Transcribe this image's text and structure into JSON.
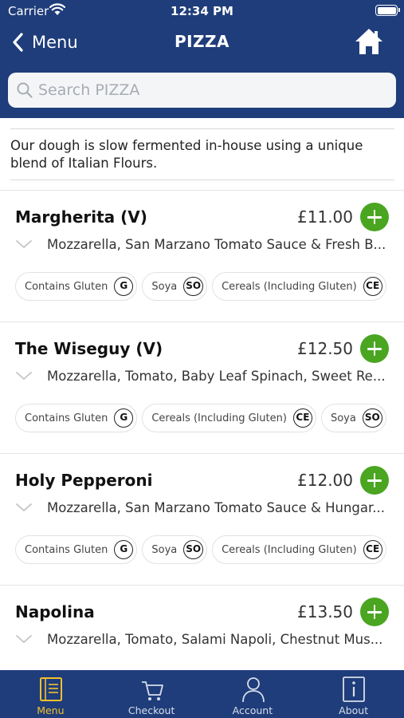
{
  "status_bar": {
    "carrier": "Carrier",
    "time": "12:34 PM",
    "battery_level": 1.0
  },
  "nav": {
    "back_label": "Menu",
    "title": "PIZZA"
  },
  "search": {
    "placeholder": "Search PIZZA",
    "value": ""
  },
  "intro_text": "Our dough is slow fermented in-house using a unique blend of Italian Flours.",
  "items": [
    {
      "name": "Margherita (V)",
      "price": "£11.00",
      "description": "Mozzarella, San Marzano Tomato Sauce & Fresh B...",
      "allergens": [
        {
          "label": "Contains Gluten",
          "code": "G"
        },
        {
          "label": "Soya",
          "code": "SO"
        },
        {
          "label": "Cereals (Including Gluten)",
          "code": "CE"
        }
      ]
    },
    {
      "name": "The Wiseguy (V)",
      "price": "£12.50",
      "description": "Mozzarella, Tomato, Baby Leaf Spinach, Sweet Re...",
      "allergens": [
        {
          "label": "Contains Gluten",
          "code": "G"
        },
        {
          "label": "Cereals (Including Gluten)",
          "code": "CE"
        },
        {
          "label": "Soya",
          "code": "SO"
        }
      ]
    },
    {
      "name": "Holy Pepperoni",
      "price": "£12.00",
      "description": "Mozzarella, San Marzano Tomato Sauce & Hungar...",
      "allergens": [
        {
          "label": "Contains Gluten",
          "code": "G"
        },
        {
          "label": "Soya",
          "code": "SO"
        },
        {
          "label": "Cereals (Including Gluten)",
          "code": "CE"
        }
      ]
    },
    {
      "name": "Napolina",
      "price": "£13.50",
      "description": "Mozzarella, Tomato, Salami Napoli, Chestnut Mus...",
      "allergens": []
    }
  ],
  "tabs": [
    {
      "label": "Menu",
      "icon": "menu-book-icon",
      "active": true
    },
    {
      "label": "Checkout",
      "icon": "cart-icon",
      "active": false
    },
    {
      "label": "Account",
      "icon": "user-icon",
      "active": false
    },
    {
      "label": "About",
      "icon": "info-icon",
      "active": false
    }
  ],
  "colors": {
    "header": "#1f3d7a",
    "add_button": "#4aa521",
    "active_tab": "#f2c02e"
  }
}
